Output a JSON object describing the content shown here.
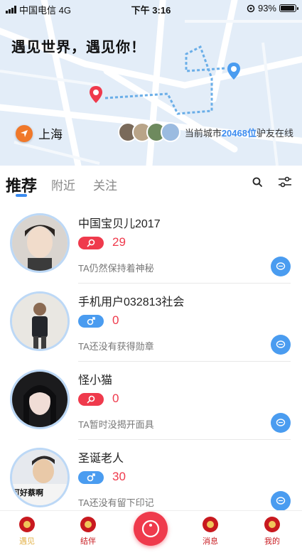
{
  "status": {
    "carrier": "中国电信 4G",
    "time": "下午 3:16",
    "battery": "93%",
    "battery_level": 0.93
  },
  "map": {
    "greeting": "遇见世界，遇见你！",
    "city": "上海",
    "online_prefix": "当前城市",
    "online_count": "20468位",
    "online_suffix": "驴友在线"
  },
  "tabs": [
    {
      "label": "推荐",
      "active": true
    },
    {
      "label": "附近",
      "active": false
    },
    {
      "label": "关注",
      "active": false
    }
  ],
  "users": [
    {
      "name": "中国宝贝儿2017",
      "gender": "female",
      "count": "29",
      "desc": "TA仍然保持着神秘"
    },
    {
      "name": "手机用户032813社会",
      "gender": "male",
      "count": "0",
      "desc": "TA还没有获得勋章"
    },
    {
      "name": "怪小猫",
      "gender": "female",
      "count": "0",
      "desc": "TA暂时没揭开面具"
    },
    {
      "name": "圣诞老人",
      "gender": "male",
      "count": "30",
      "desc": "TA还没有留下印记",
      "avatar_text": "可好蔡啊"
    }
  ],
  "nav": [
    {
      "label": "遇见",
      "color": "#e3b24a"
    },
    {
      "label": "结伴",
      "color": "#c8191f"
    },
    {
      "label": "消息",
      "color": "#c8191f"
    },
    {
      "label": "我的",
      "color": "#c8191f"
    }
  ],
  "colors": {
    "accent": "#3a8bf0",
    "female": "#ef3a4c",
    "male": "#4a9cf0",
    "center_button": "#ef3a4c"
  }
}
